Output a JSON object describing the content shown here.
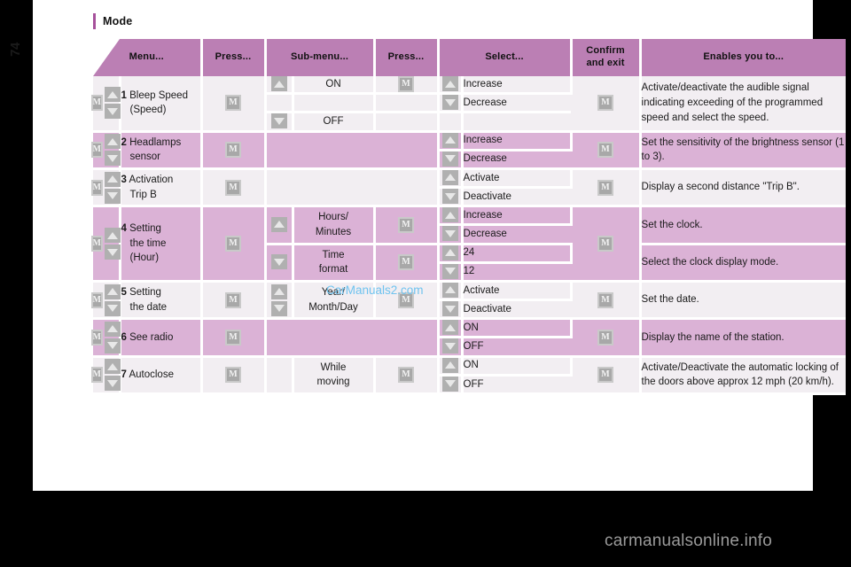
{
  "page": {
    "number": "74",
    "section_title": "Mode",
    "watermark_inner": "CarManuals2.com",
    "watermark_bottom": "carmanualsonline.info",
    "accent_color": "#a6519b",
    "header_color": "#bb7fb4",
    "row_dark_color": "#dbb2d6",
    "row_light_color": "#f2eef2"
  },
  "table": {
    "headers": [
      "Menu...",
      "Press...",
      "Sub-menu...",
      "Press...",
      "Select...",
      "Confirm and exit",
      "Enables you to..."
    ],
    "header_confirm_line1": "Confirm",
    "header_confirm_line2": "and exit",
    "button_label": "M",
    "rows": [
      {
        "num": "1",
        "menu_line1": "Bleep Speed",
        "menu_line2": "(Speed)",
        "submenu": [
          {
            "arrow": "up",
            "label": "ON"
          },
          {
            "arrow": "none",
            "label": ""
          },
          {
            "arrow": "down",
            "label": "OFF"
          }
        ],
        "select": [
          {
            "arrow": "up",
            "label": "Increase"
          },
          {
            "arrow": "down",
            "label": "Decrease"
          },
          {
            "arrow": "none",
            "label": ""
          }
        ],
        "enables": "Activate/deactivate the audible signal indicating exceeding of the programmed speed and select the speed."
      },
      {
        "num": "2",
        "menu_line1": "Headlamps",
        "menu_line2": "sensor",
        "submenu": [],
        "select": [
          {
            "arrow": "up",
            "label": "Increase"
          },
          {
            "arrow": "down",
            "label": "Decrease"
          }
        ],
        "enables": "Set the sensitivity of the brightness sensor (1 to 3)."
      },
      {
        "num": "3",
        "menu_line1": "Activation",
        "menu_line2": "Trip B",
        "submenu": [],
        "select": [
          {
            "arrow": "up",
            "label": "Activate"
          },
          {
            "arrow": "down",
            "label": "Deactivate"
          }
        ],
        "enables": "Display a second distance \"Trip B\"."
      },
      {
        "num": "4",
        "menu_line1": "Setting",
        "menu_line2": "the time",
        "menu_line3": "(Hour)",
        "subrows": [
          {
            "arrow": "up",
            "submenu_line1": "Hours/",
            "submenu_line2": "Minutes",
            "select": [
              {
                "arrow": "up",
                "label": "Increase"
              },
              {
                "arrow": "down",
                "label": "Decrease"
              }
            ],
            "enables": "Set the clock."
          },
          {
            "arrow": "down",
            "submenu_line1": "Time",
            "submenu_line2": "format",
            "select": [
              {
                "arrow": "up",
                "label": "24"
              },
              {
                "arrow": "down",
                "label": "12"
              }
            ],
            "enables": "Select the clock display mode."
          }
        ]
      },
      {
        "num": "5",
        "menu_line1": "Setting",
        "menu_line2": "the date",
        "submenu_line1": "Year/",
        "submenu_line2": "Month/Day",
        "select": [
          {
            "arrow": "up",
            "label": "Activate"
          },
          {
            "arrow": "down",
            "label": "Deactivate"
          }
        ],
        "enables": "Set the date."
      },
      {
        "num": "6",
        "menu_line1": "See radio",
        "submenu": [],
        "select": [
          {
            "arrow": "up",
            "label": "ON"
          },
          {
            "arrow": "down",
            "label": "OFF"
          }
        ],
        "enables": "Display the name of the station."
      },
      {
        "num": "7",
        "menu_line1": "Autoclose",
        "submenu_line1": "While",
        "submenu_line2": "moving",
        "select": [
          {
            "arrow": "up",
            "label": "ON"
          },
          {
            "arrow": "down",
            "label": "OFF"
          }
        ],
        "enables": "Activate/Deactivate the automatic locking of the doors above approx 12 mph (20 km/h)."
      }
    ]
  }
}
